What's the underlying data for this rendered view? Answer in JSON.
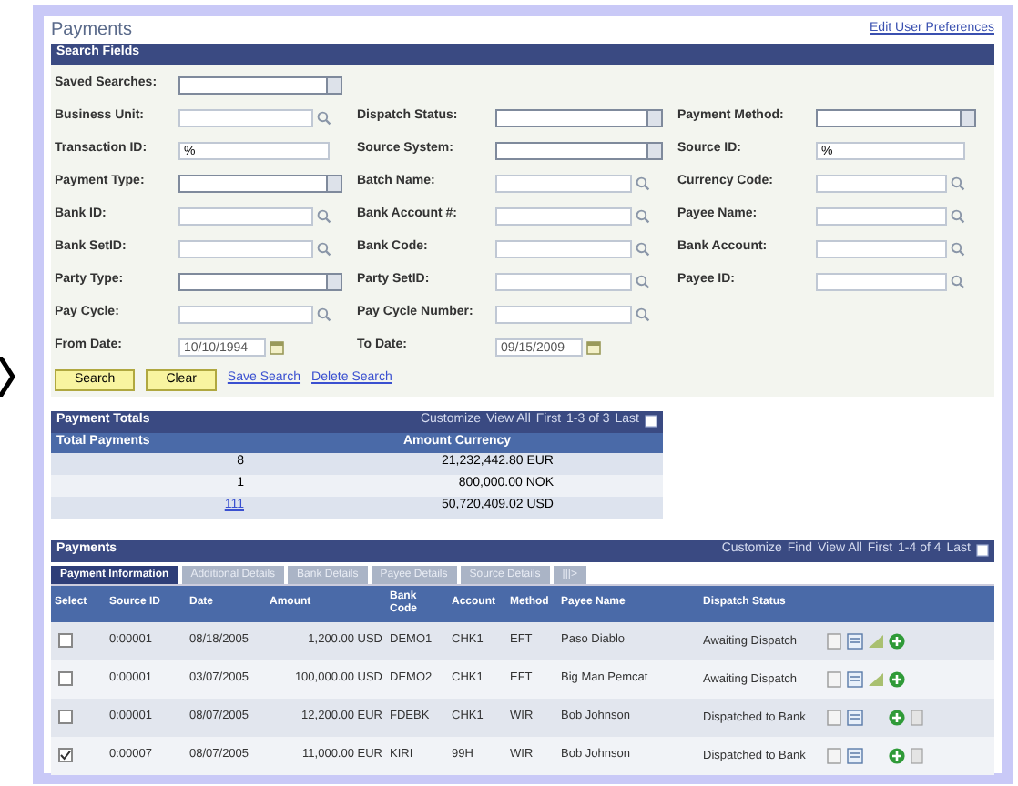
{
  "page": {
    "title": "Payments",
    "link": "Edit User Preferences"
  },
  "search": {
    "header": "Search Fields",
    "rows": [
      [
        {
          "label": "Saved Searches:",
          "kind": "select"
        }
      ],
      [
        {
          "label": "Business Unit:",
          "kind": "lookup"
        },
        {
          "label": "Dispatch Status:",
          "kind": "select"
        },
        {
          "label": "Payment Method:",
          "kind": "select"
        }
      ],
      [
        {
          "label": "Transaction ID:",
          "kind": "text",
          "value": "%"
        },
        {
          "label": "Source System:",
          "kind": "select"
        },
        {
          "label": "Source ID:",
          "kind": "text",
          "value": "%"
        }
      ],
      [
        {
          "label": "Payment Type:",
          "kind": "select"
        },
        {
          "label": "Batch Name:",
          "kind": "lookup"
        },
        {
          "label": "Currency Code:",
          "kind": "lookup"
        }
      ],
      [
        {
          "label": "Bank ID:",
          "kind": "lookup"
        },
        {
          "label": "Bank Account #:",
          "kind": "lookup"
        },
        {
          "label": "Payee Name:",
          "kind": "lookup"
        }
      ],
      [
        {
          "label": "Bank SetID:",
          "kind": "lookup"
        },
        {
          "label": "Bank Code:",
          "kind": "lookup"
        },
        {
          "label": "Bank Account:",
          "kind": "lookup"
        }
      ],
      [
        {
          "label": "Party Type:",
          "kind": "select"
        },
        {
          "label": "Party SetID:",
          "kind": "lookup"
        },
        {
          "label": "Payee ID:",
          "kind": "lookup"
        }
      ],
      [
        {
          "label": "Pay Cycle:",
          "kind": "lookup"
        },
        {
          "label": "Pay Cycle Number:",
          "kind": "lookup"
        }
      ],
      [
        {
          "label": "From Date:",
          "kind": "date",
          "value": "10/10/1994"
        },
        {
          "label": "To Date:",
          "kind": "date",
          "value": "09/15/2009"
        }
      ]
    ],
    "buttons": [
      "Search",
      "Clear"
    ],
    "links": [
      "Save Search",
      "Delete Search"
    ]
  },
  "totals": {
    "header": "Payment Totals",
    "nav": [
      "Customize",
      "View All",
      "First",
      "1-3 of 3",
      "Last"
    ],
    "columns": [
      "Total Payments",
      "Amount Currency"
    ],
    "rows": [
      {
        "count": "8",
        "amount": "21,232,442.80 EUR"
      },
      {
        "count": "1",
        "amount": "800,000.00 NOK"
      },
      {
        "count": "111",
        "amount": "50,720,409.02 USD"
      }
    ]
  },
  "payments": {
    "header": "Payments",
    "nav": [
      "Customize",
      "Find",
      "View All",
      "First",
      "1-4 of 4",
      "Last"
    ],
    "tabs": [
      {
        "label": "Payment Information",
        "selected": true
      },
      {
        "label": "Additional Details",
        "selected": false
      },
      {
        "label": "Bank Details",
        "selected": false
      },
      {
        "label": "Payee Details",
        "selected": false
      },
      {
        "label": "Source Details",
        "selected": false
      },
      {
        "label": "|||>",
        "selected": false
      }
    ],
    "columns": [
      "Select",
      "Source ID",
      "Date",
      "Amount",
      "Bank Code",
      "Account",
      "Method",
      "Payee Name",
      "Dispatch Status"
    ],
    "rows": [
      {
        "checked": false,
        "source_id": "0:00001",
        "date": "08/18/2005",
        "amount": "1,200.00 USD",
        "bank_code": "DEMO1",
        "account": "CHK1",
        "method": "EFT",
        "payee": "Paso Diablo",
        "status": "Awaiting Dispatch",
        "has_chart": true,
        "has_detail": false
      },
      {
        "checked": false,
        "source_id": "0:00001",
        "date": "03/07/2005",
        "amount": "100,000.00 USD",
        "bank_code": "DEMO2",
        "account": "CHK1",
        "method": "EFT",
        "payee": "Big Man Pemcat",
        "status": "Awaiting Dispatch",
        "has_chart": true,
        "has_detail": false
      },
      {
        "checked": false,
        "source_id": "0:00001",
        "date": "08/07/2005",
        "amount": "12,200.00 EUR",
        "bank_code": "FDEBK",
        "account": "CHK1",
        "method": "WIR",
        "payee": "Bob Johnson",
        "status": "Dispatched to Bank",
        "has_chart": false,
        "has_detail": true
      },
      {
        "checked": true,
        "source_id": "0:00007",
        "date": "08/07/2005",
        "amount": "11,000.00 EUR",
        "bank_code": "KIRI",
        "account": "99H",
        "method": "WIR",
        "payee": "Bob Johnson",
        "status": "Dispatched to Bank",
        "has_chart": false,
        "has_detail": true
      }
    ]
  }
}
